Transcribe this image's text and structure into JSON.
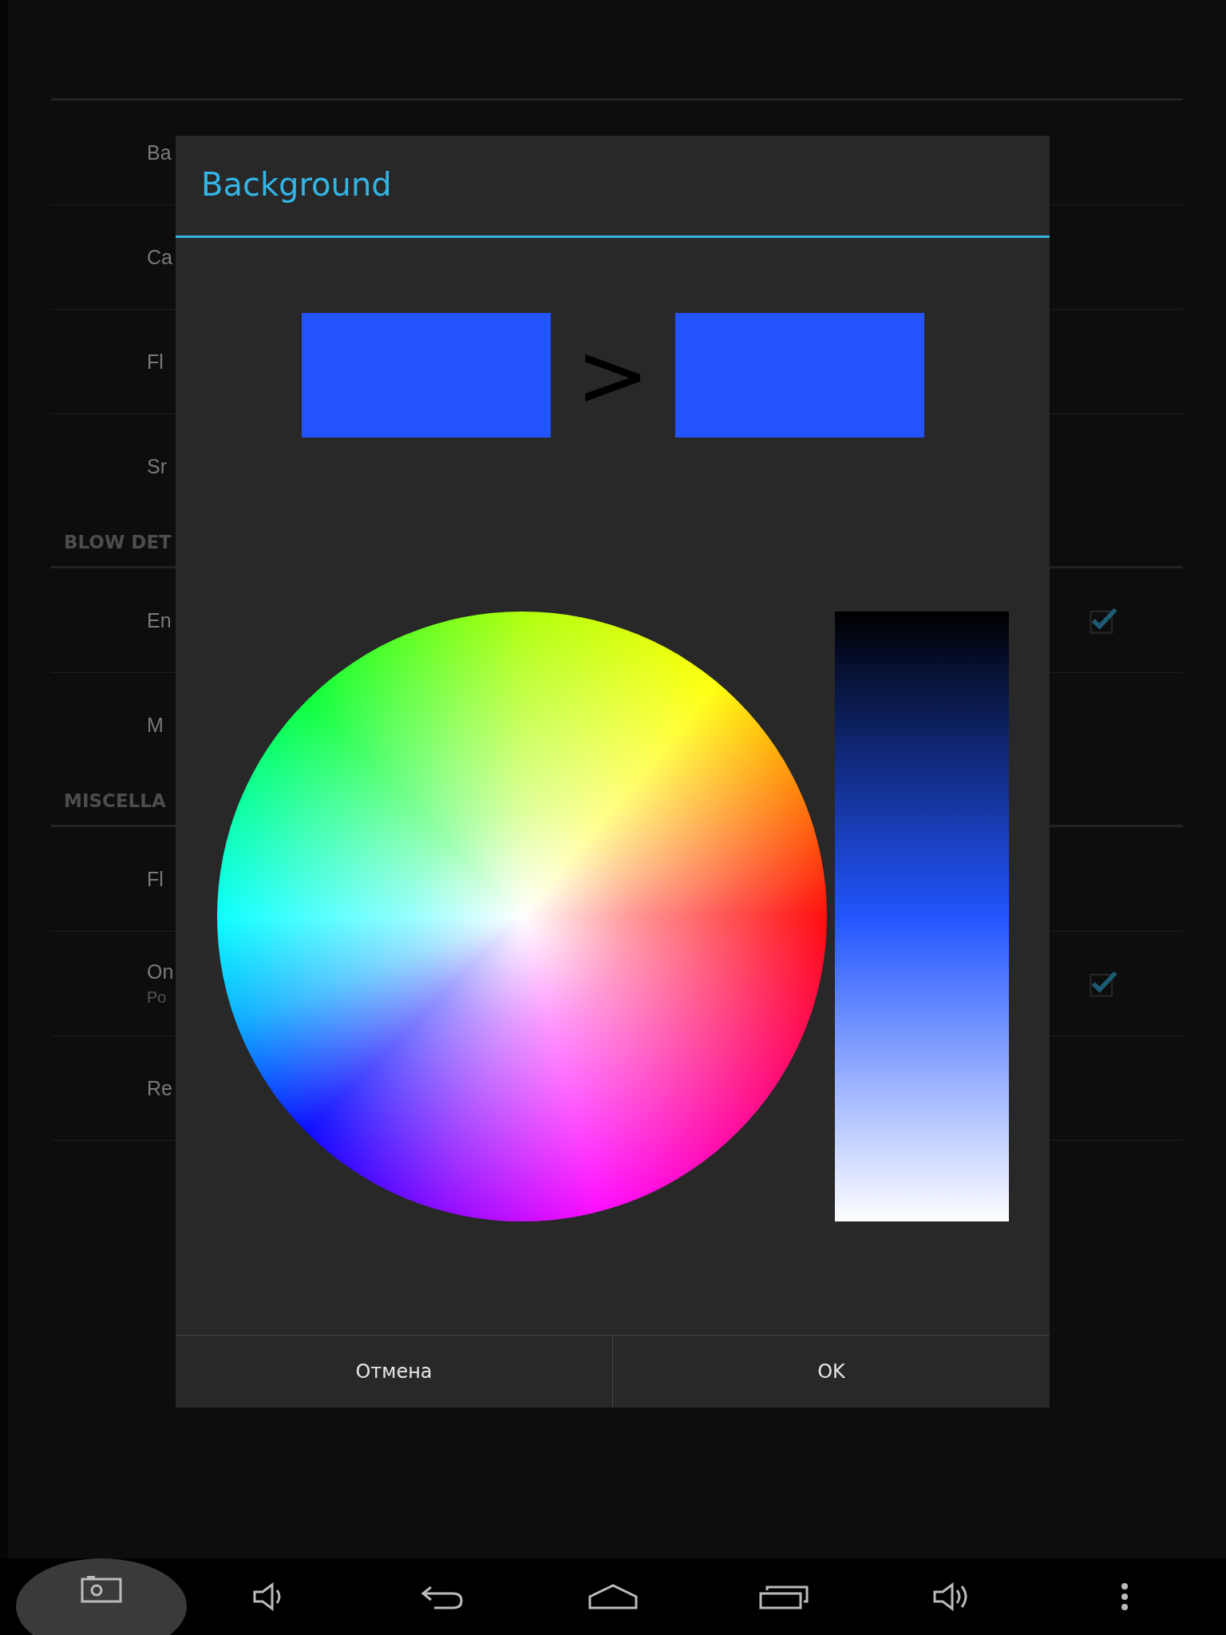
{
  "settings": {
    "sections": [
      {
        "items": [
          {
            "title": "Ba",
            "kind": "text"
          },
          {
            "title": "Ca",
            "kind": "text"
          },
          {
            "title": "Fl",
            "kind": "text"
          },
          {
            "title": "Sr",
            "kind": "text"
          }
        ]
      },
      {
        "header": "BLOW DET",
        "items": [
          {
            "title": "En",
            "kind": "checkbox",
            "checked": true
          },
          {
            "title": "M",
            "kind": "text"
          }
        ]
      },
      {
        "header": "MISCELLA",
        "items": [
          {
            "title": "Fl",
            "kind": "text"
          },
          {
            "title": "On",
            "summary": "Po",
            "kind": "checkbox",
            "checked": true
          },
          {
            "title": "Re",
            "kind": "text"
          }
        ]
      }
    ]
  },
  "dialog": {
    "title": "Background",
    "swatches": [
      {
        "color": "#2255ff"
      },
      {
        "color": "#2255ff"
      }
    ],
    "separator": ">",
    "buttons": [
      "Отмена",
      "OK"
    ]
  },
  "nav_bar": [
    {
      "kind": "camera",
      "pressed": true
    },
    {
      "kind": "volume-down",
      "pressed": false
    },
    {
      "kind": "back",
      "pressed": false
    },
    {
      "kind": "home",
      "pressed": false
    },
    {
      "kind": "recents",
      "pressed": false
    },
    {
      "kind": "volume-up",
      "pressed": false
    },
    {
      "kind": "menu",
      "pressed": false
    }
  ]
}
